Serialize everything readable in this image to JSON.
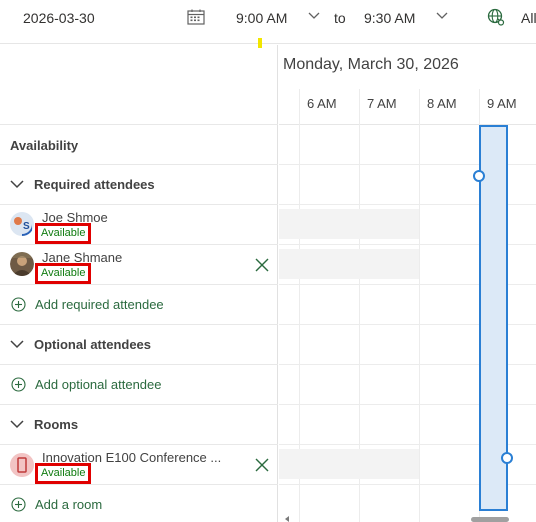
{
  "toolbar": {
    "date": "2026-03-30",
    "start_time": "9:00 AM",
    "to_label": "to",
    "end_time": "9:30 AM",
    "timezone_label": "All"
  },
  "icons": {
    "calendar": "calendar-icon",
    "chevron": "chevron-down-icon",
    "globe": "globe-icon",
    "add": "add-circle-icon",
    "remove": "close-icon"
  },
  "availability": {
    "heading": "Availability"
  },
  "sections": {
    "required": {
      "title": "Required attendees",
      "attendees": [
        {
          "name": "Joe Shmoe",
          "status": "Available"
        },
        {
          "name": "Jane Shmane",
          "status": "Available"
        }
      ],
      "add_label": "Add required attendee"
    },
    "optional": {
      "title": "Optional attendees",
      "add_label": "Add optional attendee"
    },
    "rooms": {
      "title": "Rooms",
      "items": [
        {
          "name": "Innovation E100 Conference ...",
          "status": "Available"
        }
      ],
      "add_label": "Add a room"
    }
  },
  "schedule": {
    "day_header": "Monday, March 30, 2026",
    "hours": [
      "6 AM",
      "7 AM",
      "8 AM",
      "9 AM"
    ]
  },
  "colors": {
    "accent": "#2a7fd4",
    "selection_fill": "#dce9f7",
    "status_green": "#107c10",
    "highlight_red": "#e00000",
    "add_green": "#2b6a3f"
  }
}
